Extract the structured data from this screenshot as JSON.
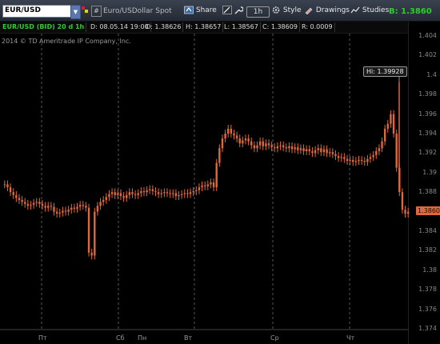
{
  "toolbar": {
    "symbol": "EUR/USD",
    "description": "Euro/USDollar Spot",
    "share_label": "Share",
    "timeframe_label": "1h",
    "style_label": "Style",
    "drawings_label": "Drawings",
    "studies_label": "Studies",
    "bid_label": "B: 1.3860"
  },
  "infobar": {
    "symbol_label": "EUR/USD (BID) 20 d 1h",
    "date": "D: 08.05.14 19:00",
    "open": "O: 1.38626",
    "high": "H: 1.38657",
    "low": "L: 1.38567",
    "close": "C: 1.38609",
    "range": "R: 0.0009"
  },
  "copyright": "2014 © TD Ameritrade IP Company, Inc.",
  "hi_label": "Hi: 1.39928",
  "last_price_tag": "1.3860",
  "colors": {
    "candle": "#e0683a",
    "accent": "#2ecc2e",
    "grid": "#444444"
  },
  "chart_data": {
    "type": "candlestick",
    "ylim": [
      1.374,
      1.404
    ],
    "y_ticks": [
      "1.404",
      "1.402",
      "1.4",
      "1.398",
      "1.396",
      "1.394",
      "1.392",
      "1.39",
      "1.388",
      "1.386",
      "1.384",
      "1.382",
      "1.38",
      "1.378",
      "1.376",
      "1.374"
    ],
    "x_ticks": [
      "Пт",
      "Сб",
      "Пн",
      "Вт",
      "Ср",
      "Чт"
    ],
    "hi_value": 1.39928,
    "last_value": 1.386,
    "series_close": [
      1.3888,
      1.3885,
      1.388,
      1.3877,
      1.3874,
      1.3872,
      1.387,
      1.3868,
      1.3866,
      1.3867,
      1.3869,
      1.387,
      1.3868,
      1.3866,
      1.3864,
      1.3866,
      1.3865,
      1.386,
      1.3858,
      1.3859,
      1.3861,
      1.386,
      1.3862,
      1.3864,
      1.3863,
      1.3865,
      1.3867,
      1.3866,
      1.3864,
      1.3818,
      1.3815,
      1.386,
      1.3866,
      1.387,
      1.3872,
      1.3875,
      1.3878,
      1.388,
      1.3877,
      1.3879,
      1.3876,
      1.3874,
      1.3877,
      1.388,
      1.3878,
      1.3877,
      1.3879,
      1.3881,
      1.388,
      1.3882,
      1.3883,
      1.3881,
      1.388,
      1.3878,
      1.3879,
      1.388,
      1.3879,
      1.3878,
      1.3879,
      1.3876,
      1.3877,
      1.3878,
      1.3879,
      1.3878,
      1.388,
      1.3881,
      1.3882,
      1.3885,
      1.3887,
      1.3886,
      1.3888,
      1.389,
      1.3885,
      1.391,
      1.3925,
      1.3935,
      1.394,
      1.3945,
      1.394,
      1.3938,
      1.3935,
      1.393,
      1.3933,
      1.3935,
      1.3932,
      1.3928,
      1.3925,
      1.3928,
      1.3932,
      1.3927,
      1.393,
      1.3928,
      1.3926,
      1.3925,
      1.3927,
      1.3928,
      1.3926,
      1.3925,
      1.3927,
      1.3924,
      1.3926,
      1.3923,
      1.3925,
      1.3922,
      1.3924,
      1.3922,
      1.392,
      1.3923,
      1.3925,
      1.3921,
      1.3924,
      1.392,
      1.3921,
      1.3919,
      1.3917,
      1.3915,
      1.3916,
      1.3914,
      1.3912,
      1.3913,
      1.3911,
      1.3912,
      1.3913,
      1.3912,
      1.3911,
      1.3914,
      1.3916,
      1.3918,
      1.3922,
      1.3925,
      1.3932,
      1.3945,
      1.395,
      1.396,
      1.394,
      1.3905,
      1.388,
      1.3862,
      1.3858,
      1.386
    ]
  }
}
